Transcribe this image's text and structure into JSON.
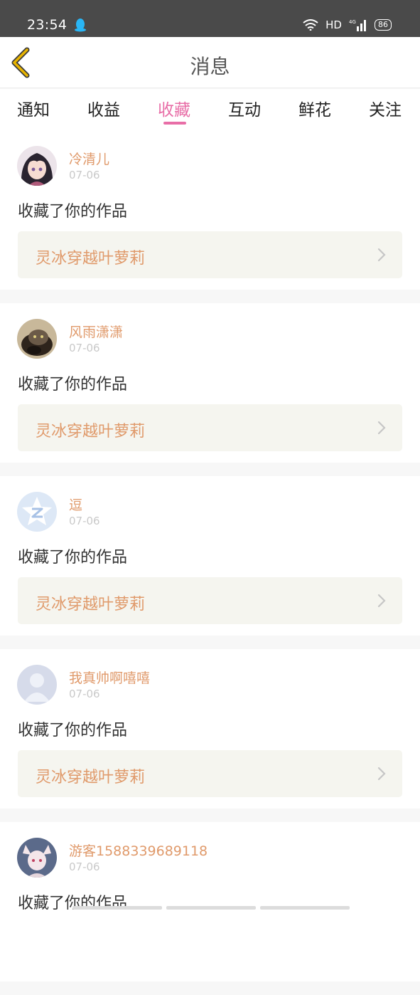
{
  "status": {
    "time": "23:54",
    "network": "HD",
    "battery": "86"
  },
  "header": {
    "title": "消息"
  },
  "tabs": [
    {
      "label": "通知"
    },
    {
      "label": "收益"
    },
    {
      "label": "收藏"
    },
    {
      "label": "互动"
    },
    {
      "label": "鲜花"
    },
    {
      "label": "关注"
    }
  ],
  "active_tab": "收藏",
  "items": [
    {
      "name": "冷清儿",
      "date": "07-06",
      "action": "收藏了你的作品",
      "work": "灵冰穿越叶萝莉"
    },
    {
      "name": "风雨潇潇",
      "date": "07-06",
      "action": "收藏了你的作品",
      "work": "灵冰穿越叶萝莉"
    },
    {
      "name": "逗",
      "date": "07-06",
      "action": "收藏了你的作品",
      "work": "灵冰穿越叶萝莉"
    },
    {
      "name": "我真帅啊嘻嘻",
      "date": "07-06",
      "action": "收藏了你的作品",
      "work": "灵冰穿越叶萝莉"
    },
    {
      "name": "游客1588339689118",
      "date": "07-06",
      "action": "收藏了你的作品",
      "work": ""
    }
  ],
  "colors": {
    "accent": "#e86ea7",
    "name": "#e09a6b",
    "back_arrow": "#e8b400"
  }
}
